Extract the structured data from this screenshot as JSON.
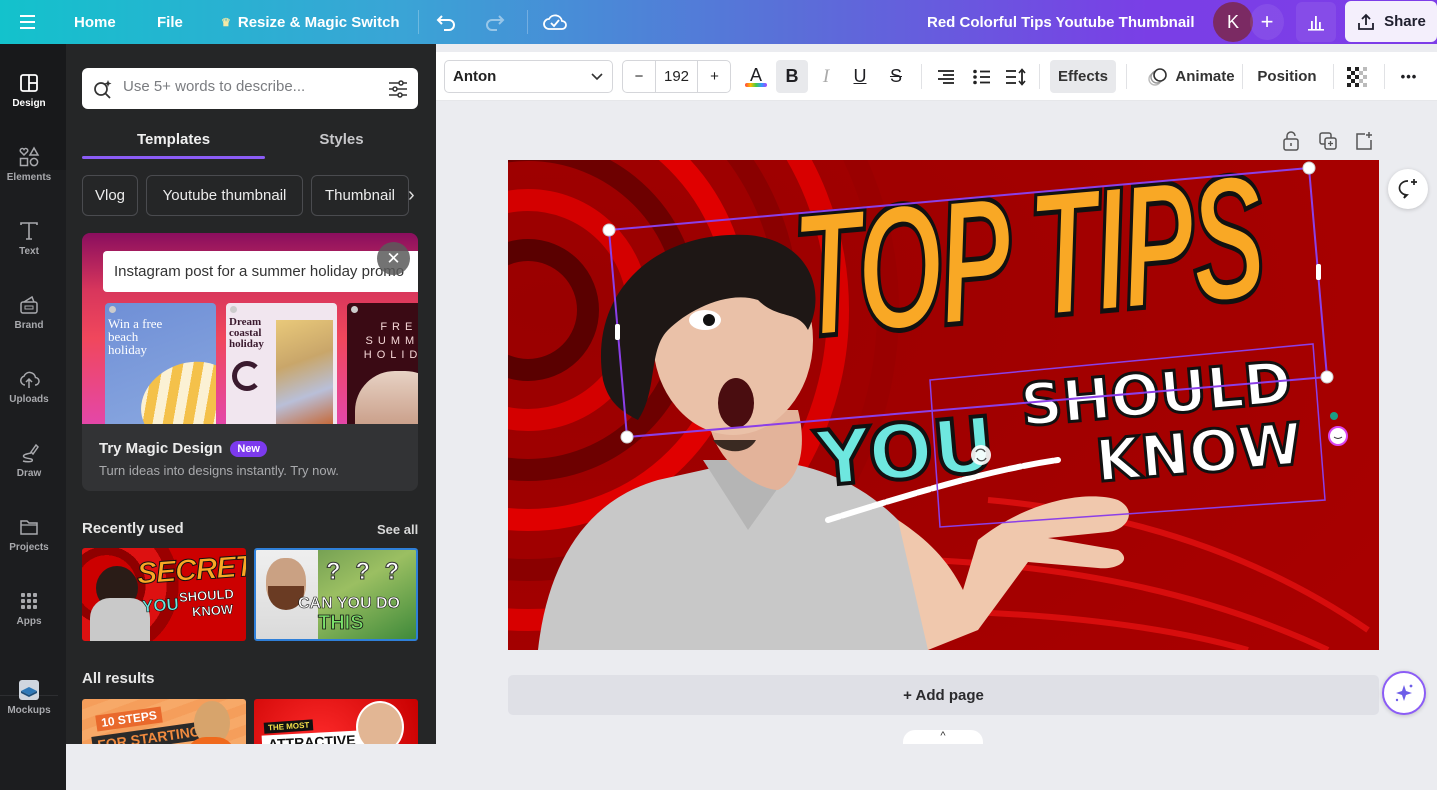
{
  "topbar": {
    "menu_icon": "hamburger-icon",
    "home": "Home",
    "file": "File",
    "resize": "Resize & Magic Switch",
    "resize_icon": "crown-icon",
    "undo_icon": "undo-icon",
    "redo_icon": "redo-icon",
    "cloud_icon": "cloud-check-icon",
    "document_title": "Red Colorful Tips Youtube Thumbnail",
    "avatar_initial": "K",
    "add_collaborator": "+",
    "insights_icon": "bar-chart-icon",
    "share": "Share",
    "share_icon": "upload-icon"
  },
  "rail": {
    "items": [
      {
        "label": "Design",
        "icon": "layout-icon",
        "active": true
      },
      {
        "label": "Elements",
        "icon": "shapes-icon"
      },
      {
        "label": "Text",
        "icon": "text-icon"
      },
      {
        "label": "Brand",
        "icon": "brand-kit-icon"
      },
      {
        "label": "Uploads",
        "icon": "cloud-upload-icon"
      },
      {
        "label": "Draw",
        "icon": "draw-icon"
      },
      {
        "label": "Projects",
        "icon": "folder-icon"
      },
      {
        "label": "Apps",
        "icon": "grid-icon"
      },
      {
        "label": "Mockups",
        "icon": "mockups-icon"
      }
    ]
  },
  "panel": {
    "search": {
      "placeholder": "Use 5+ words to describe...",
      "value": ""
    },
    "tabs": [
      {
        "label": "Templates",
        "active": true
      },
      {
        "label": "Styles"
      }
    ],
    "chips": [
      "Vlog",
      "Youtube thumbnail",
      "Thumbnail"
    ],
    "magic": {
      "prompt": "Instagram post for a summer holiday promo",
      "samples": [
        {
          "text": "Win a free beach holiday"
        },
        {
          "text": "Dream coastal holiday"
        },
        {
          "text": "FREE SUMMER HOLIDAY"
        }
      ],
      "title": "Try Magic Design",
      "badge": "New",
      "subtitle": "Turn ideas into designs instantly. Try now."
    },
    "recently_used": {
      "title": "Recently used",
      "see_all": "See all",
      "items": [
        {
          "line1": "SECRETS",
          "line2": "YOU",
          "line3": "SHOULD",
          "line4": "KNOW"
        },
        {
          "line1": "? ? ?",
          "line2": "CAN YOU DO",
          "line3": "THIS"
        }
      ]
    },
    "all_results": {
      "title": "All results",
      "items": [
        {
          "line1": "10 STEPS",
          "line2": "FOR STARTING"
        },
        {
          "line1": "THE MOST",
          "line2": "ATTRACTIVE"
        }
      ]
    }
  },
  "toolbar": {
    "font": "Anton",
    "font_size": "192",
    "decrease": "−",
    "increase": "+",
    "text_color_letter": "A",
    "bold": "B",
    "italic": "I",
    "underline": "U",
    "strike": "S",
    "effects": "Effects",
    "animate": "Animate",
    "position": "Position",
    "more": "•••"
  },
  "canvas": {
    "headline": "TOP TIPS",
    "word_you": "YOU",
    "word_should": "SHOULD",
    "word_know": "KNOW",
    "colors": {
      "headline": "#f9a825",
      "you": "#6ee7df",
      "bg": "#b30000"
    }
  },
  "add_page": "+ Add page"
}
